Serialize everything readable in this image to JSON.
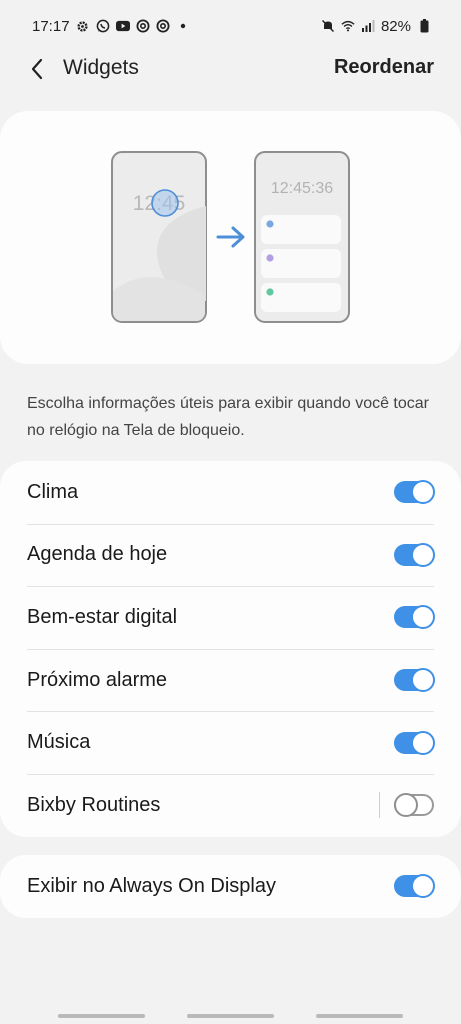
{
  "status_bar": {
    "time": "17:17",
    "left_icons": [
      "gear-icon",
      "whatsapp-icon",
      "youtube-icon",
      "threads-icon",
      "threads-icon",
      "dot-icon"
    ],
    "right_icons": [
      "mute-icon",
      "wifi-icon",
      "signal-icon"
    ],
    "battery": "82%"
  },
  "header": {
    "title": "Widgets",
    "reorder_label": "Reordenar"
  },
  "illustration": {
    "clock_before": "12:45",
    "clock_after": "12:45:36",
    "dot_colors": [
      "#7aa7e0",
      "#b49ee6",
      "#5fc8a0"
    ]
  },
  "description": "Escolha informações úteis para exibir quando você tocar no relógio na Tela de bloqueio.",
  "widgets": [
    {
      "label": "Clima",
      "enabled": true
    },
    {
      "label": "Agenda de hoje",
      "enabled": true
    },
    {
      "label": "Bem-estar digital",
      "enabled": true
    },
    {
      "label": "Próximo alarme",
      "enabled": true
    },
    {
      "label": "Música",
      "enabled": true
    },
    {
      "label": "Bixby Routines",
      "enabled": false
    }
  ],
  "aod": {
    "label": "Exibir no Always On Display",
    "enabled": true
  },
  "colors": {
    "accent": "#3e91e6",
    "background": "#f2f2f2",
    "card": "#fdfdfd"
  }
}
